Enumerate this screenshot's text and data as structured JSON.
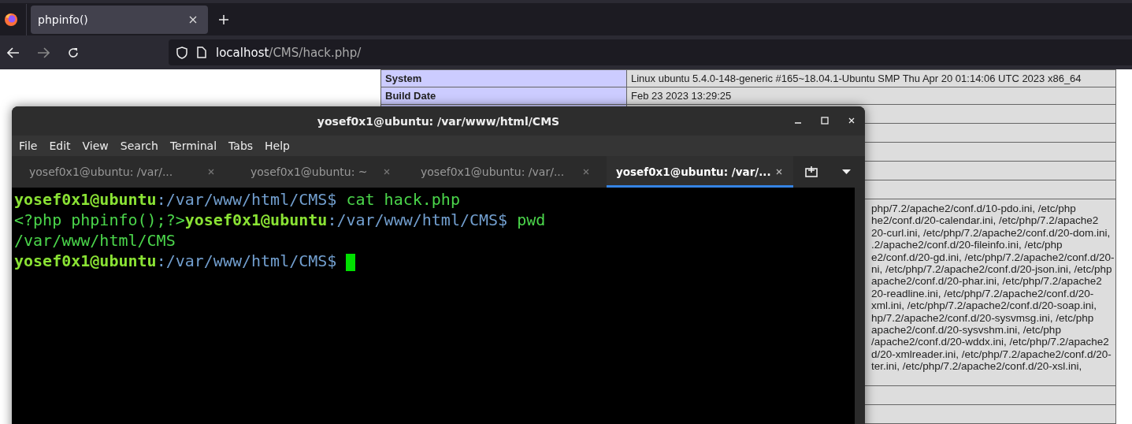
{
  "browser": {
    "tabs": [
      {
        "title": "phpinfo()",
        "selected": true
      }
    ],
    "url": {
      "host": "localhost",
      "path": "/CMS/hack.php/"
    }
  },
  "phpinfo_table": {
    "rows": [
      {
        "kind": "pair",
        "label": "System",
        "value": "Linux ubuntu 5.4.0-148-generic #165~18.04.1-Ubuntu SMP Thu Apr 20 01:14:06 UTC 2023 x86_64"
      },
      {
        "kind": "pair",
        "label": "Build Date",
        "value": "Feb 23 2023 13:29:25"
      },
      {
        "kind": "empty"
      },
      {
        "kind": "empty"
      },
      {
        "kind": "empty"
      },
      {
        "kind": "empty"
      },
      {
        "kind": "empty"
      },
      {
        "kind": "lines",
        "lines": [
          "php/7.2/apache2/conf.d/10-pdo.ini, /etc/php",
          "he2/conf.d/20-calendar.ini, /etc/php/7.2/apache2",
          "20-curl.ini, /etc/php/7.2/apache2/conf.d/20-dom.ini,",
          ".2/apache2/conf.d/20-fileinfo.ini, /etc/php",
          "e2/conf.d/20-gd.ini, /etc/php/7.2/apache2/conf.d/20-",
          "ni, /etc/php/7.2/apache2/conf.d/20-json.ini, /etc/php",
          "apache2/conf.d/20-phar.ini, /etc/php/7.2/apache2",
          "20-readline.ini, /etc/php/7.2/apache2/conf.d/20-",
          "xml.ini, /etc/php/7.2/apache2/conf.d/20-soap.ini,",
          "hp/7.2/apache2/conf.d/20-sysvmsg.ini, /etc/php",
          "apache2/conf.d/20-sysvshm.ini, /etc/php",
          "/apache2/conf.d/20-wddx.ini, /etc/php/7.2/apache2",
          "d/20-xmlreader.ini, /etc/php/7.2/apache2/conf.d/20-",
          "ter.ini, /etc/php/7.2/apache2/conf.d/20-xsl.ini,"
        ]
      },
      {
        "kind": "empty"
      },
      {
        "kind": "empty"
      }
    ]
  },
  "terminal": {
    "title": "yosef0x1@ubuntu: /var/www/html/CMS",
    "menu": [
      "File",
      "Edit",
      "View",
      "Search",
      "Terminal",
      "Tabs",
      "Help"
    ],
    "tabs": [
      {
        "label": "yosef0x1@ubuntu: /var/...",
        "selected": false
      },
      {
        "label": "yosef0x1@ubuntu: ~",
        "selected": false
      },
      {
        "label": "yosef0x1@ubuntu: /var/...",
        "selected": false
      },
      {
        "label": "yosef0x1@ubuntu: /var/...",
        "selected": true
      }
    ],
    "lines": [
      [
        {
          "kind": "user",
          "text": "yosef0x1@ubuntu"
        },
        {
          "kind": "path",
          "text": ":/var/www/html/CMS$"
        },
        {
          "kind": "output",
          "text": " cat hack.php"
        }
      ],
      [
        {
          "kind": "output",
          "text": "<?php phpinfo();?>"
        },
        {
          "kind": "user",
          "text": "yosef0x1@ubuntu"
        },
        {
          "kind": "path",
          "text": ":/var/www/html/CMS$"
        },
        {
          "kind": "output",
          "text": " pwd"
        }
      ],
      [
        {
          "kind": "output",
          "text": "/var/www/html/CMS"
        }
      ],
      [
        {
          "kind": "user",
          "text": "yosef0x1@ubuntu"
        },
        {
          "kind": "path",
          "text": ":/var/www/html/CMS$ "
        }
      ]
    ]
  }
}
